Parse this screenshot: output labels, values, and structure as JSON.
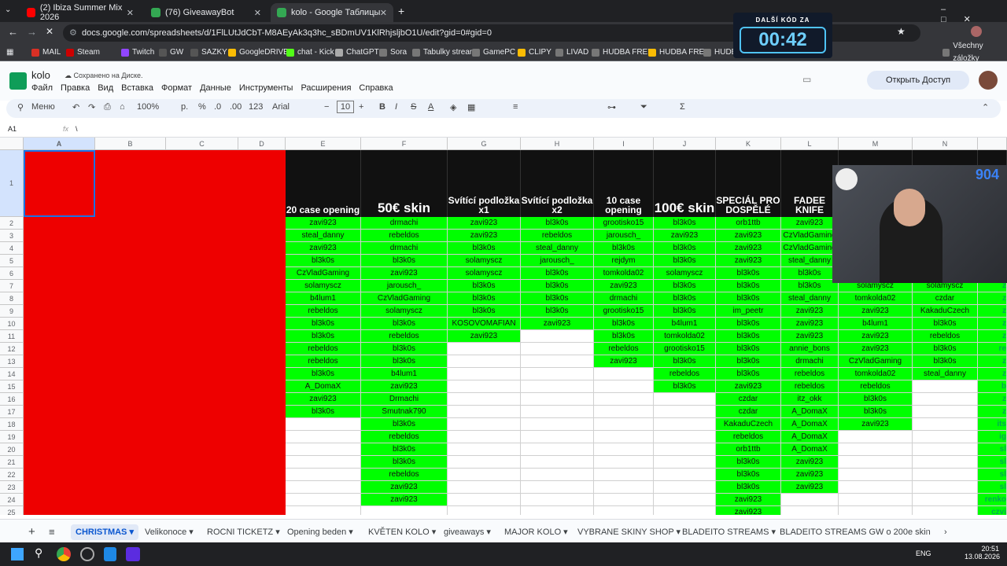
{
  "browser": {
    "tabs": [
      {
        "title": "(2) Ibiza Summer Mix 2026",
        "color": "#ff0000"
      },
      {
        "title": "(76) GiveawayBot",
        "color": "#34a853"
      },
      {
        "title": "kolo - Google Таблицы",
        "color": "#34a853"
      }
    ],
    "url": "docs.google.com/spreadsheets/d/1FlLUtJdCbT-M8AEyAk3q3hc_sBDmUV1KlRhjsljbO1U/edit?gid=0#gid=0",
    "bookmarks": [
      "MAIL",
      "Steam",
      "Twitch",
      "GW",
      "SAZKY",
      "GoogleDRIVE",
      "chat - Kick",
      "ChatGPT",
      "Sora",
      "Tabulky stream",
      "GamePC",
      "CLIPY",
      "LIVAD",
      "HUDBA FREE",
      "HUDBA FREE",
      "HUDB"
    ],
    "all_bookmarks": "Všechny záložky"
  },
  "timer": {
    "label": "DALŠÍ KÓD ZA",
    "value": "00:42"
  },
  "doc": {
    "title": "kolo",
    "saved": "Сохранено на Диске.",
    "menu": [
      "Файл",
      "Правка",
      "Вид",
      "Вставка",
      "Формат",
      "Данные",
      "Инструменты",
      "Расширения",
      "Справка"
    ],
    "share": "Открыть Доступ"
  },
  "toolbar": {
    "menu": "Меню",
    "zoom": "100%",
    "currency": "р.",
    "percent": "%",
    "dec1": ".0",
    "dec2": ".00",
    "num": "123",
    "font": "Arial",
    "size": "10"
  },
  "formula": {
    "cellref": "A1",
    "fx": "fx",
    "content": "\\"
  },
  "columns": [
    "A",
    "B",
    "C",
    "D",
    "E",
    "F",
    "G",
    "H",
    "I",
    "J",
    "K",
    "L",
    "M",
    "N",
    ""
  ],
  "headers": [
    "20 case opening",
    "50€ skin",
    "Svítící podložka x1",
    "Svítící podložka x2",
    "10 case opening",
    "100€ skin",
    "SPECIÁL PRO DOSPĚLÉ",
    "FADEE KNIFE"
  ],
  "rows": [
    [
      "zavi923",
      "drmachi",
      "zavi923",
      "bl3k0s",
      "grootisko15",
      "bl3k0s",
      "orb1ttb",
      "zavi923",
      "",
      "",
      ""
    ],
    [
      "steal_danny",
      "rebeldos",
      "zavi923",
      "rebeldos",
      "jarousch_",
      "zavi923",
      "zavi923",
      "CzVladGaming",
      "",
      "",
      ""
    ],
    [
      "zavi923",
      "drmachi",
      "bl3k0s",
      "steal_danny",
      "bl3k0s",
      "bl3k0s",
      "zavi923",
      "CzVladGaming",
      "",
      "",
      ""
    ],
    [
      "bl3k0s",
      "bl3k0s",
      "solamyscz",
      "jarousch_",
      "rejdym",
      "bl3k0s",
      "zavi923",
      "steal_danny",
      "",
      "",
      ""
    ],
    [
      "CzVladGaming",
      "zavi923",
      "solamyscz",
      "bl3k0s",
      "tomkolda02",
      "solamyscz",
      "bl3k0s",
      "bl3k0s",
      "",
      "",
      ""
    ],
    [
      "solamyscz",
      "jarousch_",
      "bl3k0s",
      "bl3k0s",
      "zavi923",
      "bl3k0s",
      "bl3k0s",
      "bl3k0s",
      "solamyscz",
      "solamyscz",
      "z"
    ],
    [
      "b4lum1",
      "CzVladGaming",
      "bl3k0s",
      "bl3k0s",
      "drmachi",
      "bl3k0s",
      "bl3k0s",
      "steal_danny",
      "tomkolda02",
      "czdar",
      "z"
    ],
    [
      "rebeldos",
      "solamyscz",
      "bl3k0s",
      "bl3k0s",
      "grootisko15",
      "bl3k0s",
      "im_peetr",
      "zavi923",
      "zavi923",
      "KakaduCzech",
      "z"
    ],
    [
      "bl3k0s",
      "bl3k0s",
      "KOSOVOMAFIAN",
      "zavi923",
      "bl3k0s",
      "b4lum1",
      "bl3k0s",
      "zavi923",
      "b4lum1",
      "bl3k0s",
      "z"
    ],
    [
      "bl3k0s",
      "rebeldos",
      "zavi923",
      "",
      "bl3k0s",
      "tomkolda02",
      "bl3k0s",
      "zavi923",
      "zavi923",
      "rebeldos",
      "z"
    ],
    [
      "rebeldos",
      "bl3k0s",
      "",
      "",
      "rebeldos",
      "grootisko15",
      "bl3k0s",
      "annie_bons",
      "zavi923",
      "bl3k0s",
      "re"
    ],
    [
      "rebeldos",
      "bl3k0s",
      "",
      "",
      "zavi923",
      "bl3k0s",
      "bl3k0s",
      "drmachi",
      "CzVladGaming",
      "bl3k0s",
      "z"
    ],
    [
      "bl3k0s",
      "b4lum1",
      "",
      "",
      "",
      "rebeldos",
      "bl3k0s",
      "rebeldos",
      "tomkolda02",
      "steal_danny",
      "z"
    ],
    [
      "A_DomaX",
      "zavi923",
      "",
      "",
      "",
      "bl3k0s",
      "zavi923",
      "rebeldos",
      "rebeldos",
      "",
      "b"
    ],
    [
      "zavi923",
      "Drmachi",
      "",
      "",
      "",
      "",
      "czdar",
      "itz_okk",
      "bl3k0s",
      "",
      "z"
    ],
    [
      "bl3k0s",
      "Smutnak790",
      "",
      "",
      "",
      "",
      "czdar",
      "A_DomaX",
      "bl3k0s",
      "",
      "z"
    ],
    [
      "",
      "bl3k0s",
      "",
      "",
      "",
      "",
      "KakaduCzech",
      "A_DomaX",
      "zavi923",
      "",
      "its"
    ],
    [
      "",
      "rebeldos",
      "",
      "",
      "",
      "",
      "rebeldos",
      "A_DomaX",
      "",
      "",
      "ig"
    ],
    [
      "",
      "bl3k0s",
      "",
      "",
      "",
      "",
      "orb1ttb",
      "A_DomaX",
      "",
      "",
      "sl"
    ],
    [
      "",
      "bl3k0s",
      "",
      "",
      "",
      "",
      "bl3k0s",
      "zavi923",
      "",
      "",
      "sl"
    ],
    [
      "",
      "rebeldos",
      "",
      "",
      "",
      "",
      "bl3k0s",
      "zavi923",
      "",
      "",
      "sl"
    ],
    [
      "",
      "zavi923",
      "",
      "",
      "",
      "",
      "bl3k0s",
      "zavi923",
      "",
      "",
      "sl"
    ],
    [
      "",
      "zavi923",
      "",
      "",
      "",
      "",
      "zavi923",
      "",
      "",
      "",
      "renko"
    ],
    [
      "",
      "",
      "",
      "",
      "",
      "",
      "zavi923",
      "",
      "",
      "",
      "czvi"
    ]
  ],
  "sheets": [
    "CHRISTMAS",
    "Velikonoce",
    "ROCNI TICKETZ",
    "Opening beden",
    "KVĚTEN KOLO",
    "giveaways",
    "MAJOR KOLO",
    "VYBRANE SKINY SHOP",
    "BLADEITO STREAMS",
    "BLADEITO STREAMS GW o 200e skin"
  ],
  "webcam": {
    "number": "904"
  },
  "taskbar": {
    "lang": "ENG",
    "time": "20:51",
    "date": "13.08.2026"
  },
  "colors": {
    "red": "#ee0000",
    "green": "#00ff00",
    "header_black": "#111111",
    "accent": "#0b57d0"
  }
}
